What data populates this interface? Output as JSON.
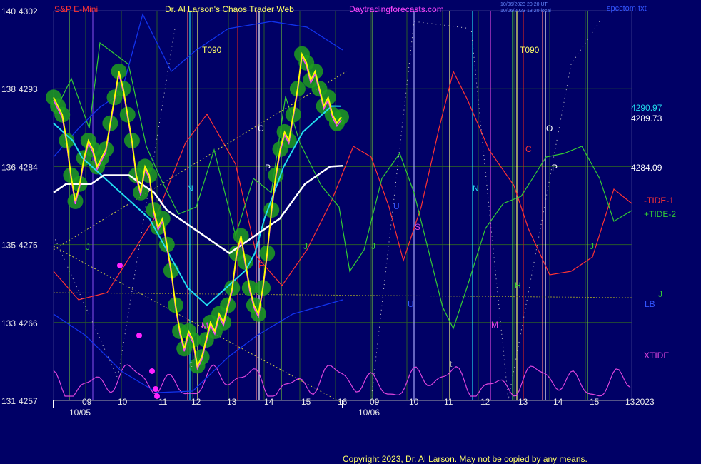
{
  "header": {
    "symbol": "S&P E-Mini",
    "title": "Dr. Al Larson's Chaos Trader Web",
    "site": "Daytradingforecasts.com",
    "stamp1": "10/06/2023 20:20 UT",
    "stamp2": "10/06/2023 13:20 local",
    "file": "spcctom.txt"
  },
  "footer": {
    "copyright": "Copyright 2023, Dr. Al Larson. May not be copied by any means."
  },
  "colors": {
    "background": "#000066",
    "grid": "#2a5a2a",
    "price": "#ffff00",
    "price_glow": "#1e9e1e",
    "avg_fast": "#22ddee",
    "avg_slow": "#ffffff",
    "tide1": "#ff3333",
    "tide2": "#33cc33",
    "xtide": "#dd44dd",
    "band": "#1133ee",
    "label_text": "#e8e8e8",
    "title_yellow": "#ffff66",
    "title_magenta": "#ff44ff",
    "symbol_red": "#ff3333"
  },
  "chart_data": {
    "type": "line",
    "y_axis": {
      "ylim": [
        4257,
        4302
      ],
      "ticks": [
        {
          "value": 4302,
          "label": "4302",
          "cycle": "140"
        },
        {
          "value": 4293,
          "label": "4293",
          "cycle": "138"
        },
        {
          "value": 4284,
          "label": "4284",
          "cycle": "136"
        },
        {
          "value": 4275,
          "label": "4275",
          "cycle": "135"
        },
        {
          "value": 4266,
          "label": "4266",
          "cycle": "133"
        },
        {
          "value": 4257,
          "label": "4257",
          "cycle": "131"
        }
      ]
    },
    "x_axis": {
      "hour_labels": [
        "09",
        "10",
        "11",
        "12",
        "13",
        "14",
        "15",
        "16",
        "09",
        "10",
        "11",
        "12",
        "13",
        "14",
        "15",
        "13"
      ],
      "dates": [
        "10/05",
        "10/06"
      ],
      "year": "2023"
    },
    "right_labels": {
      "avg_fast": "4290.97",
      "last_price": "4289.73",
      "avg_slow": "4284.09",
      "tide1": "-TIDE-1",
      "tide2": "+TIDE-2",
      "lb": "LB",
      "j": "J",
      "xtide": "XTIDE"
    },
    "annotations": [
      {
        "text": "T090",
        "color": "#ffff66"
      },
      {
        "text": "T090",
        "color": "#ffff66"
      },
      {
        "text": "J",
        "color": "#33cc33"
      },
      {
        "text": "N",
        "color": "#22ddee"
      },
      {
        "text": "N",
        "color": "#22ddee"
      },
      {
        "text": "C",
        "color": "#ffffff"
      },
      {
        "text": "P",
        "color": "#ffffff"
      },
      {
        "text": "O",
        "color": "#ffffff"
      },
      {
        "text": "P",
        "color": "#ffffff"
      },
      {
        "text": "C",
        "color": "#ff3333"
      },
      {
        "text": "U",
        "color": "#3355ff"
      },
      {
        "text": "S",
        "color": "#dd44dd"
      },
      {
        "text": "M",
        "color": "#dd44dd"
      },
      {
        "text": "M",
        "color": "#dd44dd"
      },
      {
        "text": "H",
        "color": "#33cc33"
      },
      {
        "text": "t",
        "color": "#aaaaaa"
      },
      {
        "text": "t",
        "color": "#aaaaaa"
      },
      {
        "text": "E",
        "color": "#ff3333"
      },
      {
        "text": "J",
        "color": "#33cc33"
      },
      {
        "text": "J",
        "color": "#33cc33"
      },
      {
        "text": "J",
        "color": "#33cc33"
      },
      {
        "text": "U",
        "color": "#3355ff"
      }
    ],
    "series": [
      {
        "name": "price",
        "values": [
          4292,
          4291,
          4290,
          4287,
          4283,
          4280,
          4282,
          4285,
          4287,
          4286,
          4284,
          4285,
          4286,
          4289,
          4292,
          4295,
          4293,
          4290,
          4287,
          4283,
          4281,
          4284,
          4283,
          4279,
          4277,
          4278,
          4275,
          4272,
          4268,
          4265,
          4263,
          4265,
          4264,
          4261,
          4262,
          4264,
          4266,
          4265,
          4267,
          4266,
          4268,
          4270,
          4274,
          4276,
          4273,
          4270,
          4268,
          4267,
          4270,
          4274,
          4279,
          4283,
          4286,
          4288,
          4287,
          4290,
          4293,
          4297,
          4296,
          4294,
          4295,
          4293,
          4291,
          4292,
          4290,
          4289,
          4289.73
        ]
      },
      {
        "name": "avg_fast",
        "values": [
          4289,
          4288,
          4287,
          4285,
          4284,
          4283,
          4282,
          4281,
          4280,
          4279,
          4278,
          4276,
          4274,
          4272,
          4270,
          4269,
          4268,
          4269,
          4270,
          4271,
          4272,
          4274,
          4278,
          4281,
          4284,
          4286,
          4288,
          4289,
          4290,
          4291,
          4290.97
        ]
      },
      {
        "name": "avg_slow",
        "values": [
          4281,
          4282,
          4282,
          4282,
          4283,
          4283,
          4283,
          4282,
          4281,
          4279,
          4278,
          4277,
          4276,
          4275,
          4274,
          4275,
          4276,
          4277,
          4278,
          4280,
          4282,
          4283,
          4284,
          4284.09
        ]
      },
      {
        "name": "-TIDE-1"
      },
      {
        "name": "+TIDE-2"
      },
      {
        "name": "XTIDE"
      }
    ]
  }
}
